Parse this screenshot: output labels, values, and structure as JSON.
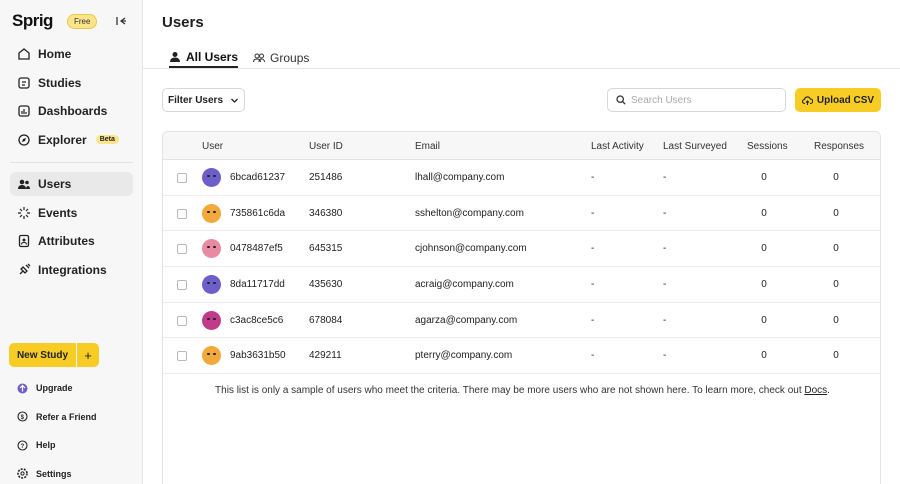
{
  "app": {
    "logo": "Sprig",
    "plan_badge": "Free"
  },
  "sidebar": {
    "primary": [
      {
        "label": "Home",
        "icon": "home-icon"
      },
      {
        "label": "Studies",
        "icon": "studies-icon"
      },
      {
        "label": "Dashboards",
        "icon": "dashboards-icon"
      },
      {
        "label": "Explorer",
        "icon": "explorer-icon",
        "badge": "Beta"
      }
    ],
    "secondary": [
      {
        "label": "Users",
        "icon": "users-icon",
        "active": true
      },
      {
        "label": "Events",
        "icon": "events-icon"
      },
      {
        "label": "Attributes",
        "icon": "attributes-icon"
      },
      {
        "label": "Integrations",
        "icon": "integrations-icon"
      }
    ],
    "new_study_label": "New Study",
    "new_study_plus": "+",
    "footer": [
      {
        "label": "Upgrade",
        "icon": "upgrade-icon"
      },
      {
        "label": "Refer a Friend",
        "icon": "refer-icon"
      },
      {
        "label": "Help",
        "icon": "help-icon"
      },
      {
        "label": "Settings",
        "icon": "settings-icon"
      }
    ]
  },
  "page": {
    "title": "Users"
  },
  "tabs": [
    {
      "label": "All Users",
      "active": true
    },
    {
      "label": "Groups",
      "active": false
    }
  ],
  "toolbar": {
    "filter_label": "Filter Users",
    "search_placeholder": "Search Users",
    "upload_label": "Upload CSV"
  },
  "table": {
    "columns": [
      "User",
      "User ID",
      "Email",
      "Last Activity",
      "Last Surveyed",
      "Sessions",
      "Responses"
    ],
    "rows": [
      {
        "user": "6bcad61237",
        "user_id": "251486",
        "email": "lhall@company.com",
        "last_activity": "-",
        "last_surveyed": "-",
        "sessions": "0",
        "responses": "0",
        "avatar_color": "purple"
      },
      {
        "user": "735861c6da",
        "user_id": "346380",
        "email": "sshelton@company.com",
        "last_activity": "-",
        "last_surveyed": "-",
        "sessions": "0",
        "responses": "0",
        "avatar_color": "orange"
      },
      {
        "user": "0478487ef5",
        "user_id": "645315",
        "email": "cjohnson@company.com",
        "last_activity": "-",
        "last_surveyed": "-",
        "sessions": "0",
        "responses": "0",
        "avatar_color": "pink"
      },
      {
        "user": "8da11717dd",
        "user_id": "435630",
        "email": "acraig@company.com",
        "last_activity": "-",
        "last_surveyed": "-",
        "sessions": "0",
        "responses": "0",
        "avatar_color": "purple"
      },
      {
        "user": "c3ac8ce5c6",
        "user_id": "678084",
        "email": "agarza@company.com",
        "last_activity": "-",
        "last_surveyed": "-",
        "sessions": "0",
        "responses": "0",
        "avatar_color": "magenta"
      },
      {
        "user": "9ab3631b50",
        "user_id": "429211",
        "email": "pterry@company.com",
        "last_activity": "-",
        "last_surveyed": "-",
        "sessions": "0",
        "responses": "0",
        "avatar_color": "orange"
      }
    ],
    "footnote_text": "This list is only a sample of users who meet the criteria. There may be more users who are not shown here. To learn more, check out ",
    "footnote_link": "Docs",
    "footnote_end": "."
  },
  "colors": {
    "accent": "#f7cd25",
    "badge": "#fbe58a",
    "sidebar_bg": "#f7f7f7"
  }
}
